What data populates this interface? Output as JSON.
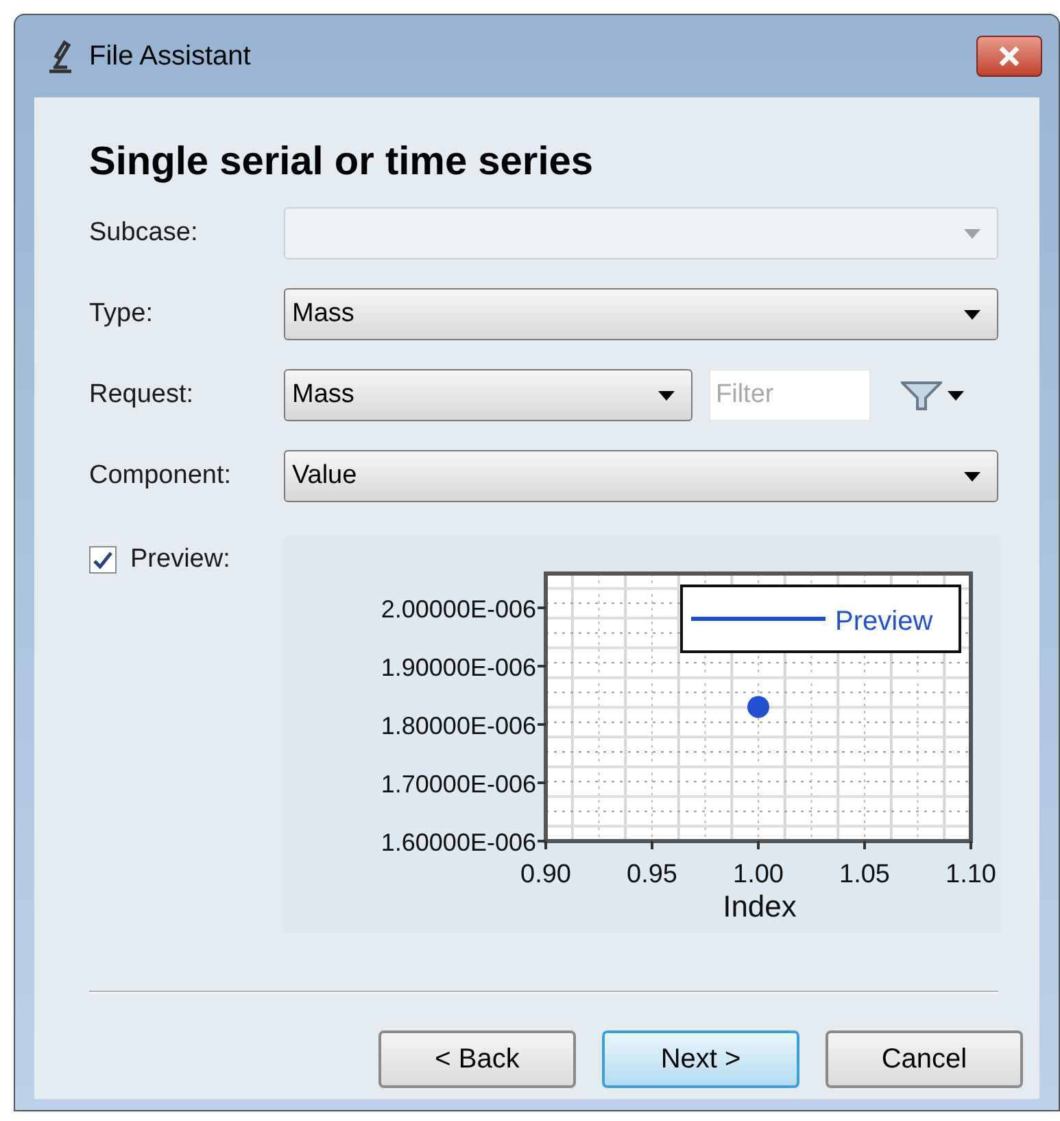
{
  "window": {
    "title": "File Assistant"
  },
  "heading": "Single serial or time series",
  "fields": [
    {
      "kind": "combo",
      "label": "Subcase:",
      "disabled": true
    },
    {
      "kind": "combo",
      "label": "Type:",
      "value": "Mass",
      "disabled": false
    },
    {
      "kind": "combo_filter",
      "label": "Request:",
      "value": "Mass",
      "disabled": false,
      "filter_placeholder": "Filter"
    },
    {
      "kind": "combo",
      "label": "Component:",
      "value": "Value",
      "disabled": false
    }
  ],
  "preview": {
    "label": "Preview:",
    "checked": true,
    "chart_data": {
      "type": "scatter",
      "xlabel": "Index",
      "xlim": [
        0.9,
        1.1
      ],
      "ylim": [
        1.6e-06,
        2.0588e-06
      ],
      "xticks": [
        {
          "value": 0.9,
          "label": "0.90"
        },
        {
          "value": 0.95,
          "label": "0.95"
        },
        {
          "value": 1.0,
          "label": "1.00"
        },
        {
          "value": 1.05,
          "label": "1.05"
        },
        {
          "value": 1.1,
          "label": "1.10"
        }
      ],
      "yticks": [
        {
          "value": 1.6e-06,
          "label": "1.60000E-006"
        },
        {
          "value": 1.7e-06,
          "label": "1.70000E-006"
        },
        {
          "value": 1.8e-06,
          "label": "1.80000E-006"
        },
        {
          "value": 1.9e-06,
          "label": "1.90000E-006"
        },
        {
          "value": 2e-06,
          "label": "2.00000E-006"
        }
      ],
      "grid": true,
      "x": [
        1.0
      ],
      "series": [
        {
          "name": "Preview",
          "color": "#2350d0",
          "values": [
            1.83e-06
          ]
        }
      ]
    }
  },
  "buttons": [
    {
      "label": "< Back",
      "default": false
    },
    {
      "label": "Next >",
      "default": true
    },
    {
      "label": "Cancel",
      "default": false
    }
  ]
}
